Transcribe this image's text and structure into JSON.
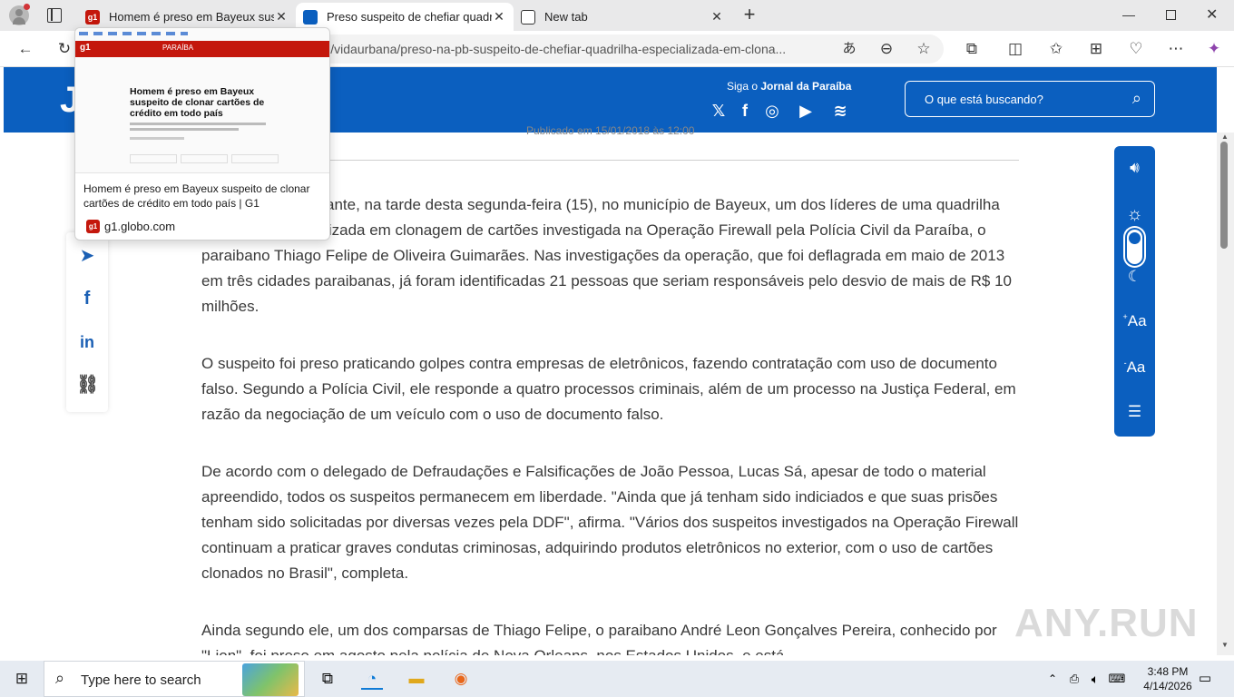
{
  "browser": {
    "tabs": [
      {
        "title": "Homem é preso em Bayeux suspeito de clonar",
        "favicon": "g1"
      },
      {
        "title": "Preso suspeito de chefiar quadrilha",
        "favicon": "jp"
      },
      {
        "title": "New tab",
        "favicon": "newtab"
      }
    ],
    "new_tab_label": "+",
    "url": "diano/vidaurbana/preso-na-pb-suspeito-de-chefiar-quadrilha-especializada-em-clona..."
  },
  "hover_card": {
    "preview_headline": "Homem é preso em Bayeux suspeito de clonar cartões de crédito em todo país",
    "preview_brand": "g1",
    "preview_section": "PARAÍBA",
    "title": "Homem é preso em Bayeux suspeito de clonar cartões de crédito em todo país | G1",
    "site": "g1.globo.com"
  },
  "site": {
    "logo": "J",
    "follow_prefix": "Siga o",
    "follow_name": "Jornal da Paraíba",
    "search_placeholder": "O que está buscando?"
  },
  "article": {
    "published": "Publicado em 15/01/2018 às 12:00",
    "paragraphs": [
      "Foi preso em flagrante, na tarde desta segunda-feira (15), no município de Bayeux, um dos líderes de uma quadrilha criminosa especializada em clonagem de cartões investigada na Operação Firewall pela Polícia Civil da Paraíba, o paraibano Thiago Felipe de Oliveira Guimarães. Nas investigações da operação, que foi deflagrada em maio de 2013 em três cidades paraibanas, já foram identificadas 21 pessoas que seriam responsáveis pelo desvio de mais de R$ 10 milhões.",
      "O suspeito foi preso praticando golpes contra empresas de eletrônicos, fazendo contratação com uso de documento falso. Segundo a Polícia Civil, ele responde a quatro processos criminais, além de um processo na Justiça Federal, em razão da negociação de um veículo com o uso de documento falso.",
      "De acordo com o delegado de Defraudações e Falsificações de João Pessoa, Lucas Sá, apesar de todo o material apreendido, todos os suspeitos permanecem em liberdade. \"Ainda que já tenham sido indiciados e que suas prisões tenham sido solicitadas por diversas vezes pela DDF\", afirma. \"Vários dos suspeitos investigados na Operação Firewall continuam a praticar graves condutas criminosas, adquirindo produtos eletrônicos no exterior, com o uso de cartões clonados no Brasil\", completa.",
      "Ainda segundo ele, um dos comparsas de Thiago Felipe, o paraibano André Leon Gonçalves Pereira, conhecido por \"Lion\", foi preso em agosto pela polícia de Nova Orleans, nos Estados Unidos, e está"
    ]
  },
  "accessibility": {
    "font_increase": "Aa",
    "font_decrease": "Aa"
  },
  "watermark": "ANY.RUN",
  "taskbar": {
    "search_placeholder": "Type here to search",
    "time": "3:48 PM",
    "date": "4/14/2026"
  }
}
